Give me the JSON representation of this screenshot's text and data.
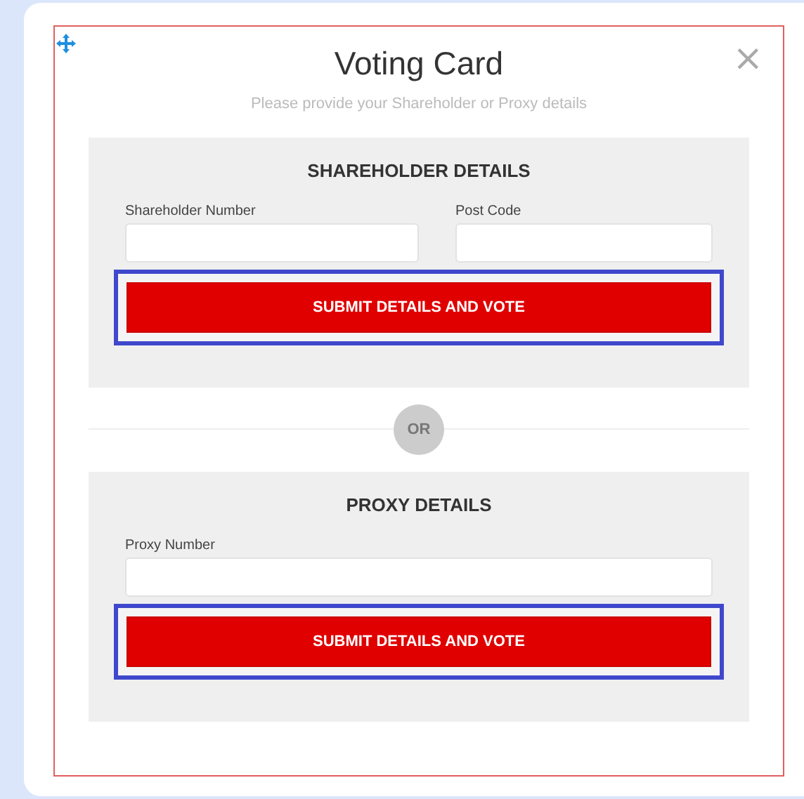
{
  "dialog": {
    "title": "Voting Card",
    "subtitle": "Please provide your Shareholder or Proxy details",
    "close": "×"
  },
  "sections": [
    {
      "heading": "SHAREHOLDER DETAILS",
      "fields": [
        {
          "label": "Shareholder Number",
          "wide": true
        },
        {
          "label": "Post Code",
          "wide": false
        }
      ],
      "button": {
        "label": "SUBMIT DETAILS AND VOTE",
        "highlighted": true
      }
    },
    {
      "heading": "PROXY DETAILS",
      "fields": [
        {
          "label": "Proxy Number",
          "wide": true
        }
      ],
      "button": {
        "label": "SUBMIT DETAILS AND VOTE",
        "highlighted": true
      }
    }
  ],
  "separator": "OR"
}
